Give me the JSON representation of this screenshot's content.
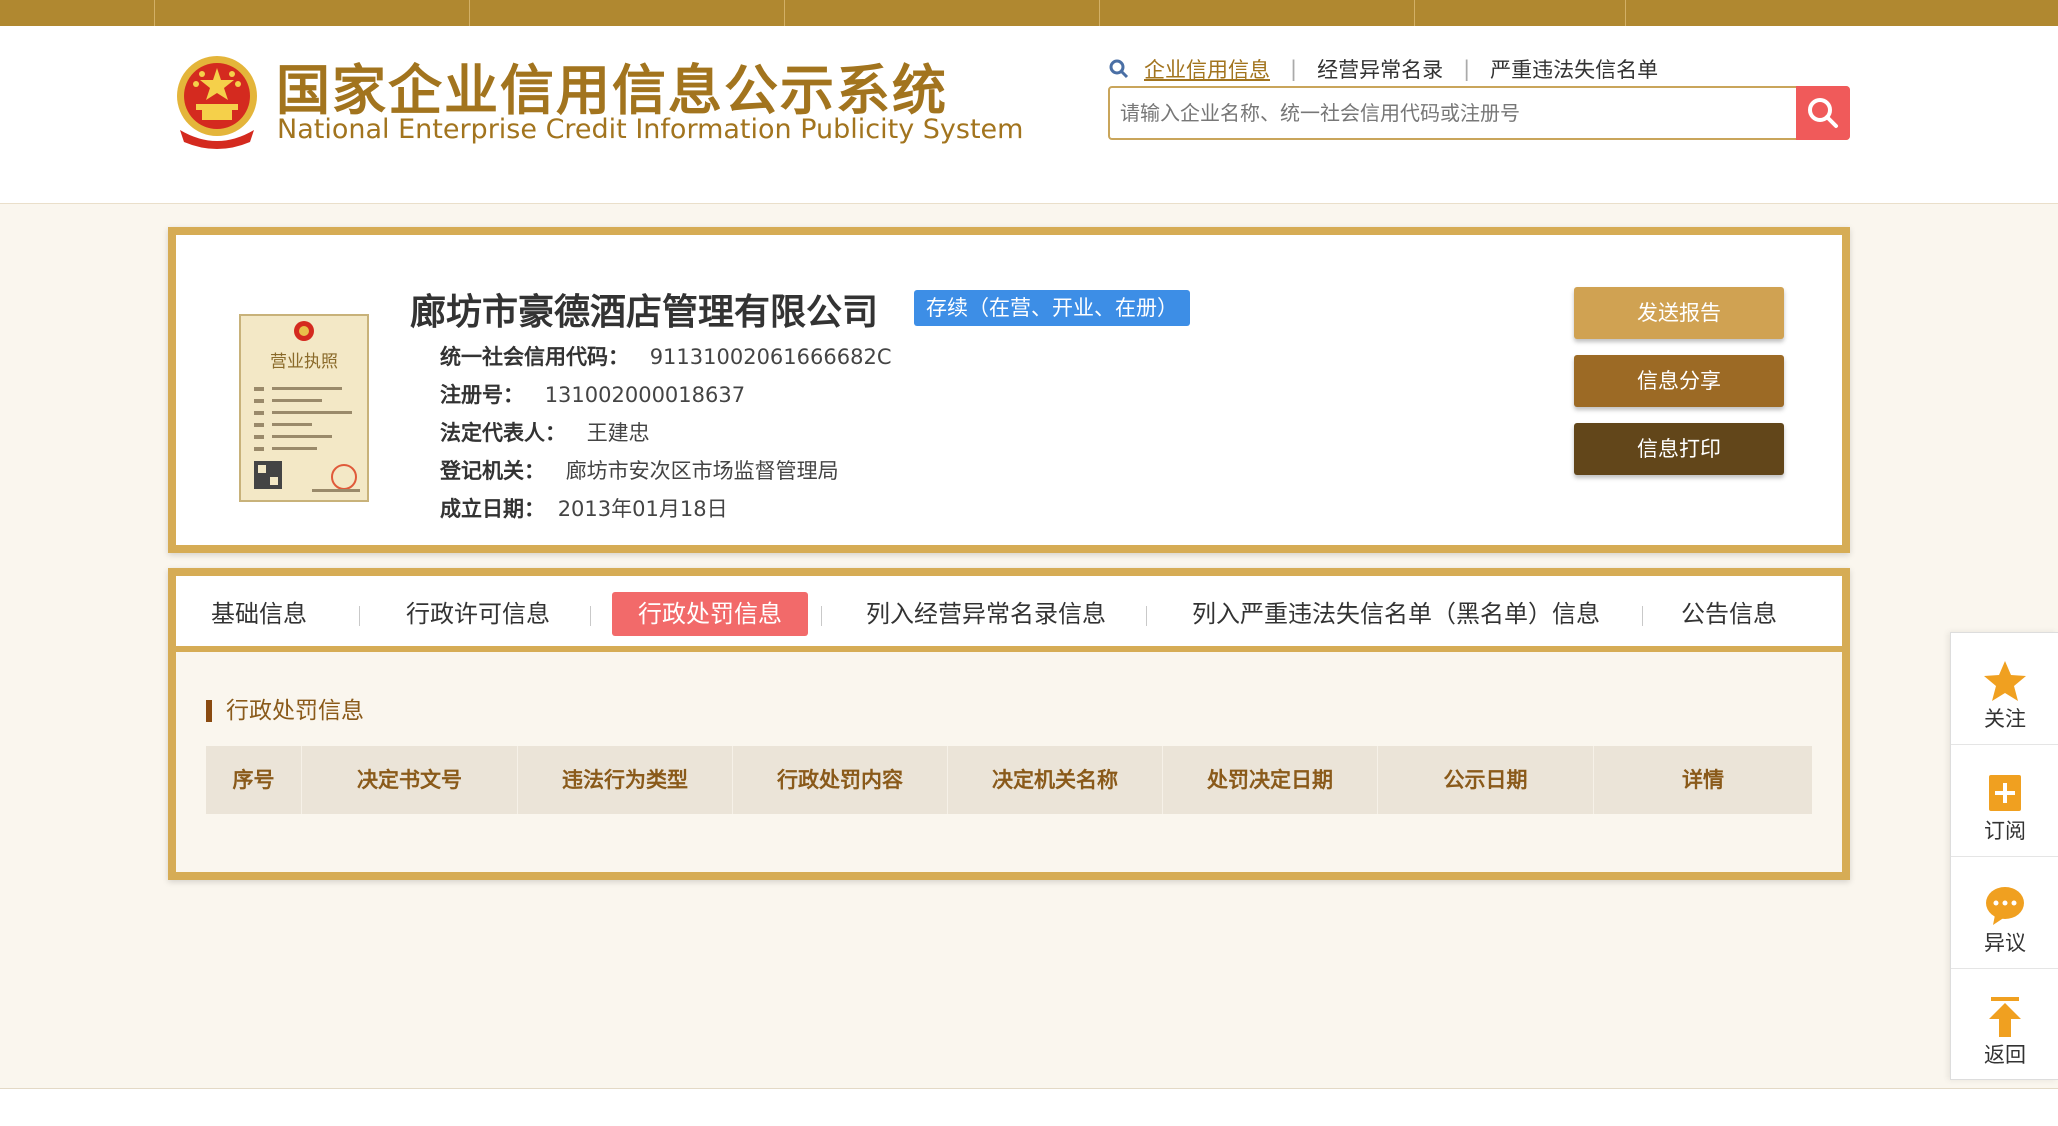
{
  "header": {
    "title_cn": "国家企业信用信息公示系统",
    "title_en": "National Enterprise Credit Information Publicity System",
    "links": [
      "企业信用信息",
      "经营异常名录",
      "严重违法失信名单"
    ],
    "search_placeholder": "请输入企业名称、统一社会信用代码或注册号"
  },
  "company": {
    "name": "廊坊市豪德酒店管理有限公司",
    "status": "存续（在营、开业、在册）",
    "credit_code_label": "统一社会信用代码：",
    "credit_code": "91131002061666682C",
    "reg_no_label": "注册号：",
    "reg_no": "131002000018637",
    "legal_rep_label": "法定代表人：",
    "legal_rep": "王建忠",
    "authority_label": "登记机关：",
    "authority": "廊坊市安次区市场监督管理局",
    "est_date_label": "成立日期：",
    "est_date": "2013年01月18日",
    "license_text": "营业执照"
  },
  "actions": {
    "send_report": "发送报告",
    "share": "信息分享",
    "print": "信息打印"
  },
  "tabs": [
    "基础信息",
    "行政许可信息",
    "行政处罚信息",
    "列入经营异常名录信息",
    "列入严重违法失信名单（黑名单）信息",
    "公告信息"
  ],
  "section": {
    "title": "行政处罚信息",
    "columns": [
      "序号",
      "决定书文号",
      "违法行为类型",
      "行政处罚内容",
      "决定机关名称",
      "处罚决定日期",
      "公示日期",
      "详情"
    ]
  },
  "sidebar": [
    "关注",
    "订阅",
    "异议",
    "返回"
  ],
  "colors": {
    "gold": "#d6ac55",
    "brand_text": "#a2741e",
    "status_blue": "#3d8ee6",
    "active_tab": "#f26a6a",
    "btn_send": "#d0a252",
    "btn_share": "#9c6a25",
    "btn_print": "#62461a"
  }
}
